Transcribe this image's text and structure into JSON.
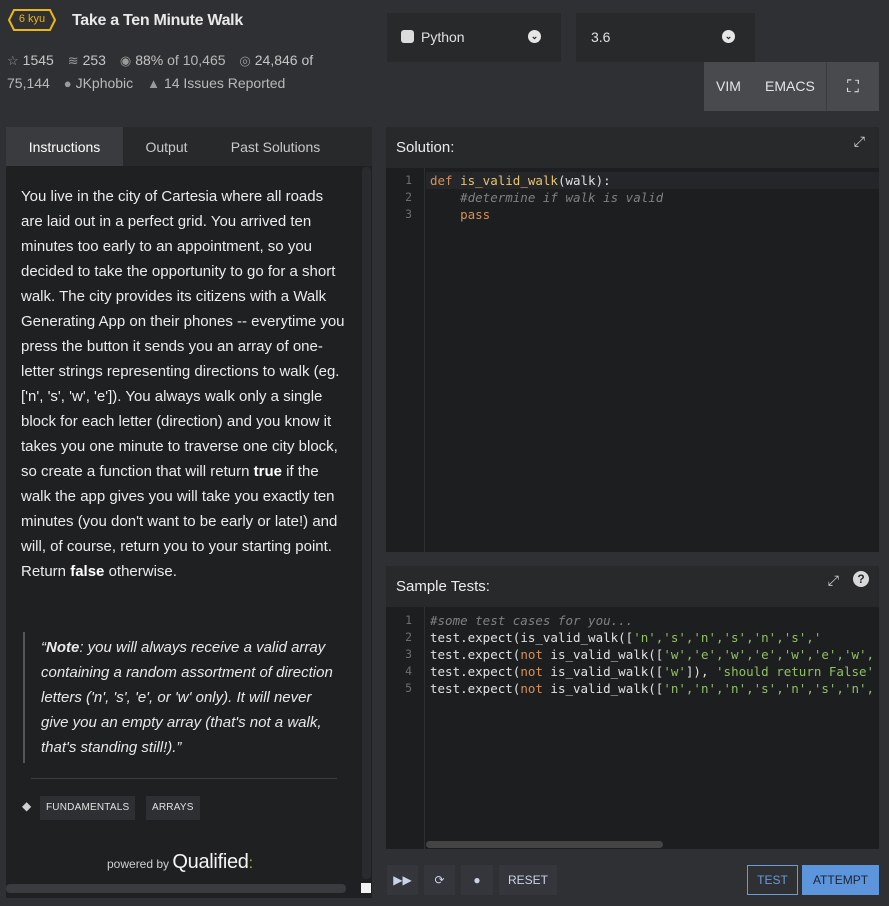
{
  "kata": {
    "rank": "6 kyu",
    "title": "Take a Ten Minute Walk",
    "stars": "1545",
    "collections": "253",
    "satisfaction": "88%",
    "satisfaction_of": "of 10,465",
    "completed": "24,846 of",
    "completed_total": "75,144",
    "author": "JKphobic",
    "issues": "14 Issues Reported"
  },
  "language": {
    "selected": "Python",
    "version": "3.6"
  },
  "modes": {
    "vim": "VIM",
    "emacs": "EMACS"
  },
  "tabs": [
    "Instructions",
    "Output",
    "Past Solutions"
  ],
  "instructions": {
    "p1_part1": "You live in the city of Cartesia where all roads are laid out in a perfect grid. You arrived ten minutes too early to an appointment, so you decided to take the opportunity to go for a short walk. The city provides its citizens with a Walk Generating App on their phones -- everytime you press the button it sends you an array of one-letter strings representing directions to walk (eg. ['n', 's', 'w', 'e']). You always walk only a single block for each letter (direction) and you know it takes you one minute to traverse one city block, so create a function that will return ",
    "p1_true": "true",
    "p1_part2": " if the walk the app gives you will take you exactly ten minutes (you don't want to be early or late!) and will, of course, return you to your starting point. Return ",
    "p1_false": "false",
    "p1_part3": " otherwise.",
    "quote_open": "“",
    "quote_bold": "Note",
    "quote_rest": ": you will always receive a valid array containing a random assortment of direction letters ('n', 's', 'e', or 'w' only). It will never give you an empty array (that's not a walk, that's standing still!).”"
  },
  "tags": [
    "FUNDAMENTALS",
    "ARRAYS"
  ],
  "powered": {
    "by": "powered by",
    "brand": "Qualified",
    "dots": ":"
  },
  "solution": {
    "header": "Solution:",
    "line_numbers": [
      "1",
      "2",
      "3"
    ],
    "lines": {
      "l1_kw": "def",
      "l1_fn": "is_valid_walk",
      "l1_rest": "(walk):",
      "l2": "    #determine if walk is valid",
      "l3": "    pass"
    }
  },
  "tests": {
    "header": "Sample Tests:",
    "help": "?",
    "line_numbers": [
      "1",
      "2",
      "3",
      "4",
      "5"
    ],
    "lines": {
      "l1": "#some test cases for you...",
      "l2_a": "test",
      "l2_b": ".expect(is_valid_walk([",
      "l2_c": "'n','s','n','s','n','s','",
      "l3_a": "test",
      "l3_b": ".expect(",
      "l3_c": "not",
      "l3_d": " is_valid_walk([",
      "l3_e": "'w','e','w','e','w','e','w',",
      "l4_a": "test",
      "l4_b": ".expect(",
      "l4_c": "not",
      "l4_d": " is_valid_walk([",
      "l4_e": "'w'",
      "l4_f": "]), ",
      "l4_g": "'should return False'",
      "l5_a": "test",
      "l5_b": ".expect(",
      "l5_c": "not",
      "l5_d": " is_valid_walk([",
      "l5_e": "'n','n','n','s','n','s','n',"
    }
  },
  "actions": {
    "reset": "RESET",
    "test": "TEST",
    "attempt": "ATTEMPT"
  },
  "colors": {
    "rank": "#ecb613",
    "accent": "#5d95dd",
    "background": "#2f3033"
  }
}
